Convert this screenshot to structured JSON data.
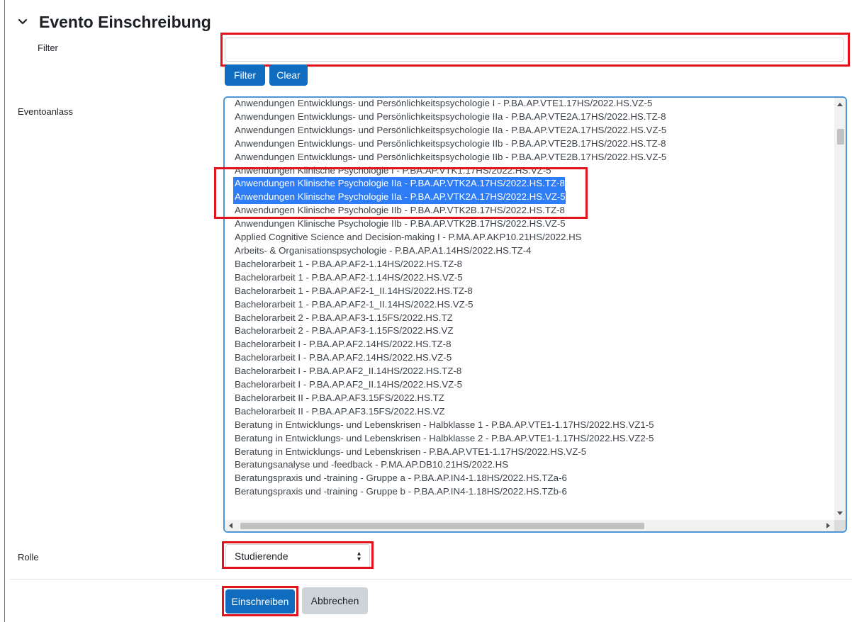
{
  "section": {
    "title": "Evento Einschreibung"
  },
  "filter": {
    "label": "Filter",
    "value": "",
    "filter_button": "Filter",
    "clear_button": "Clear"
  },
  "event": {
    "label": "Eventoanlass",
    "options": [
      {
        "text": "Anwendungen Entwicklungs- und Persönlichkeitspsychologie I - P.BA.AP.VTE1.17HS/2022.HS.VZ-5",
        "selected": false
      },
      {
        "text": "Anwendungen Entwicklungs- und Persönlichkeitspsychologie IIa - P.BA.AP.VTE2A.17HS/2022.HS.TZ-8",
        "selected": false
      },
      {
        "text": "Anwendungen Entwicklungs- und Persönlichkeitspsychologie IIa - P.BA.AP.VTE2A.17HS/2022.HS.VZ-5",
        "selected": false
      },
      {
        "text": "Anwendungen Entwicklungs- und Persönlichkeitspsychologie IIb - P.BA.AP.VTE2B.17HS/2022.HS.TZ-8",
        "selected": false
      },
      {
        "text": "Anwendungen Entwicklungs- und Persönlichkeitspsychologie IIb - P.BA.AP.VTE2B.17HS/2022.HS.VZ-5",
        "selected": false
      },
      {
        "text": "Anwendungen Klinische Psychologie I - P.BA.AP.VTK1.17HS/2022.HS.VZ-5",
        "selected": false
      },
      {
        "text": "Anwendungen Klinische Psychologie IIa - P.BA.AP.VTK2A.17HS/2022.HS.TZ-8",
        "selected": true
      },
      {
        "text": "Anwendungen Klinische Psychologie IIa - P.BA.AP.VTK2A.17HS/2022.HS.VZ-5",
        "selected": true
      },
      {
        "text": "Anwendungen Klinische Psychologie IIb - P.BA.AP.VTK2B.17HS/2022.HS.TZ-8",
        "selected": false
      },
      {
        "text": "Anwendungen Klinische Psychologie IIb - P.BA.AP.VTK2B.17HS/2022.HS.VZ-5",
        "selected": false
      },
      {
        "text": "Applied Cognitive Science and Decision-making I - P.MA.AP.AKP10.21HS/2022.HS",
        "selected": false
      },
      {
        "text": "Arbeits- & Organisationspsychologie - P.BA.AP.A1.14HS/2022.HS.TZ-4",
        "selected": false
      },
      {
        "text": "Bachelorarbeit 1 - P.BA.AP.AF2-1.14HS/2022.HS.TZ-8",
        "selected": false
      },
      {
        "text": "Bachelorarbeit 1 - P.BA.AP.AF2-1.14HS/2022.HS.VZ-5",
        "selected": false
      },
      {
        "text": "Bachelorarbeit 1 - P.BA.AP.AF2-1_II.14HS/2022.HS.TZ-8",
        "selected": false
      },
      {
        "text": "Bachelorarbeit 1 - P.BA.AP.AF2-1_II.14HS/2022.HS.VZ-5",
        "selected": false
      },
      {
        "text": "Bachelorarbeit 2 - P.BA.AP.AF3-1.15FS/2022.HS.TZ",
        "selected": false
      },
      {
        "text": "Bachelorarbeit 2 - P.BA.AP.AF3-1.15FS/2022.HS.VZ",
        "selected": false
      },
      {
        "text": "Bachelorarbeit I - P.BA.AP.AF2.14HS/2022.HS.TZ-8",
        "selected": false
      },
      {
        "text": "Bachelorarbeit I - P.BA.AP.AF2.14HS/2022.HS.VZ-5",
        "selected": false
      },
      {
        "text": "Bachelorarbeit I - P.BA.AP.AF2_II.14HS/2022.HS.TZ-8",
        "selected": false
      },
      {
        "text": "Bachelorarbeit I - P.BA.AP.AF2_II.14HS/2022.HS.VZ-5",
        "selected": false
      },
      {
        "text": "Bachelorarbeit II - P.BA.AP.AF3.15FS/2022.HS.TZ",
        "selected": false
      },
      {
        "text": "Bachelorarbeit II - P.BA.AP.AF3.15FS/2022.HS.VZ",
        "selected": false
      },
      {
        "text": "Beratung in Entwicklungs- und Lebenskrisen - Halbklasse 1 - P.BA.AP.VTE1-1.17HS/2022.HS.VZ1-5",
        "selected": false
      },
      {
        "text": "Beratung in Entwicklungs- und Lebenskrisen - Halbklasse 2 - P.BA.AP.VTE1-1.17HS/2022.HS.VZ2-5",
        "selected": false
      },
      {
        "text": "Beratung in Entwicklungs- und Lebenskrisen - P.BA.AP.VTE1-1.17HS/2022.HS.VZ-5",
        "selected": false
      },
      {
        "text": "Beratungsanalyse und -feedback - P.MA.AP.DB10.21HS/2022.HS",
        "selected": false
      },
      {
        "text": "Beratungspraxis und -training - Gruppe a - P.BA.AP.IN4-1.18HS/2022.HS.TZa-6",
        "selected": false
      },
      {
        "text": "Beratungspraxis und -training - Gruppe b - P.BA.AP.IN4-1.18HS/2022.HS.TZb-6",
        "selected": false
      }
    ]
  },
  "role": {
    "label": "Rolle",
    "selected": "Studierende"
  },
  "actions": {
    "submit": "Einschreiben",
    "cancel": "Abbrechen"
  },
  "colors": {
    "primary": "#0f6cbf",
    "highlight": "#e3121b",
    "selection": "#2f7df6",
    "focus_border": "#4c95d6"
  },
  "icons": {
    "section_toggle": "chevron-down-icon",
    "select_arrows": "updown-arrows-icon"
  }
}
